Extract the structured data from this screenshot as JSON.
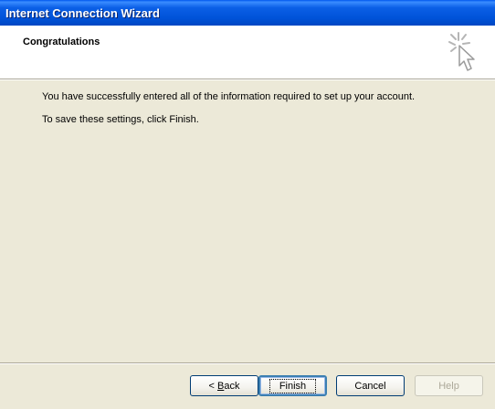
{
  "window": {
    "title": "Internet Connection Wizard"
  },
  "header": {
    "heading": "Congratulations",
    "icon": "wizard-cursor-sparkle-icon"
  },
  "content": {
    "line1": "You have successfully entered all of the information required to set up your account.",
    "line2": "To save these settings, click Finish."
  },
  "buttons": {
    "back_prefix": "< ",
    "back_mnemonic": "B",
    "back_rest": "ack",
    "finish": "Finish",
    "cancel": "Cancel",
    "help": "Help"
  }
}
